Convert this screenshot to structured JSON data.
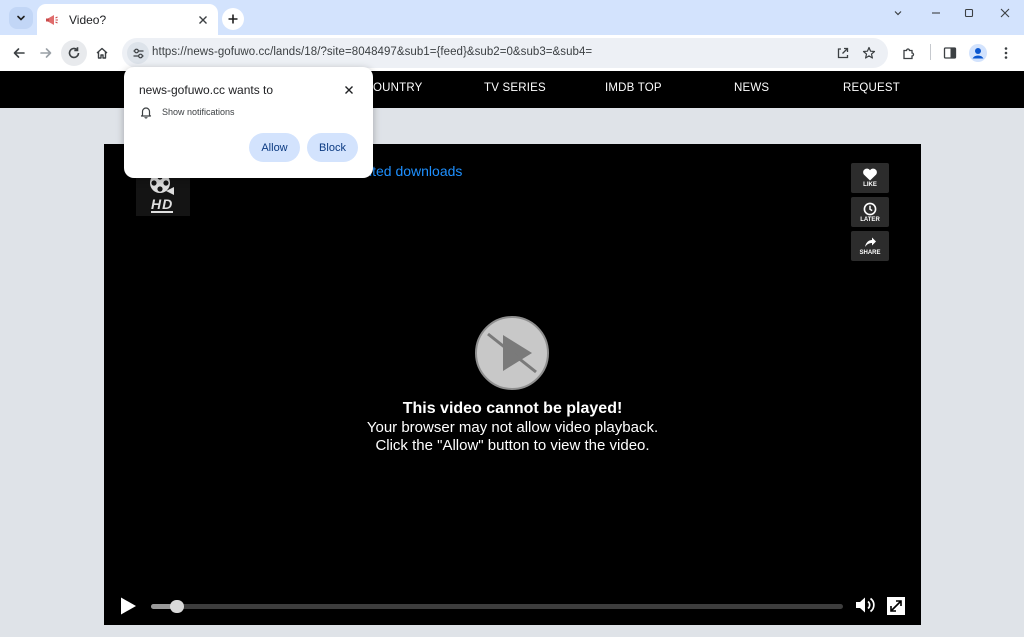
{
  "browser": {
    "tab_title": "Video?",
    "url": "https://news-gofuwo.cc/lands/18/?site=8048497&sub1={feed}&sub2=0&sub3=&sub4="
  },
  "site_nav": {
    "items": [
      "OUNTRY",
      "TV SERIES",
      "IMDB TOP",
      "NEWS",
      "REQUEST"
    ]
  },
  "player": {
    "logo_text": "HD",
    "link_text": "ited downloads",
    "side_buttons": [
      "LIKE",
      "LATER",
      "SHARE"
    ],
    "message_title": "This video cannot be played!",
    "message_line1": "Your browser may not allow video playback.",
    "message_line2": "Click the \"Allow\" button to view the video.",
    "progress": 0.03
  },
  "permission_popup": {
    "title": "news-gofuwo.cc wants to",
    "item": "Show notifications",
    "allow_label": "Allow",
    "block_label": "Block"
  },
  "colors": {
    "tabstrip": "#d3e3fd",
    "link": "#1e90ff",
    "button": "#d3e3fd"
  }
}
